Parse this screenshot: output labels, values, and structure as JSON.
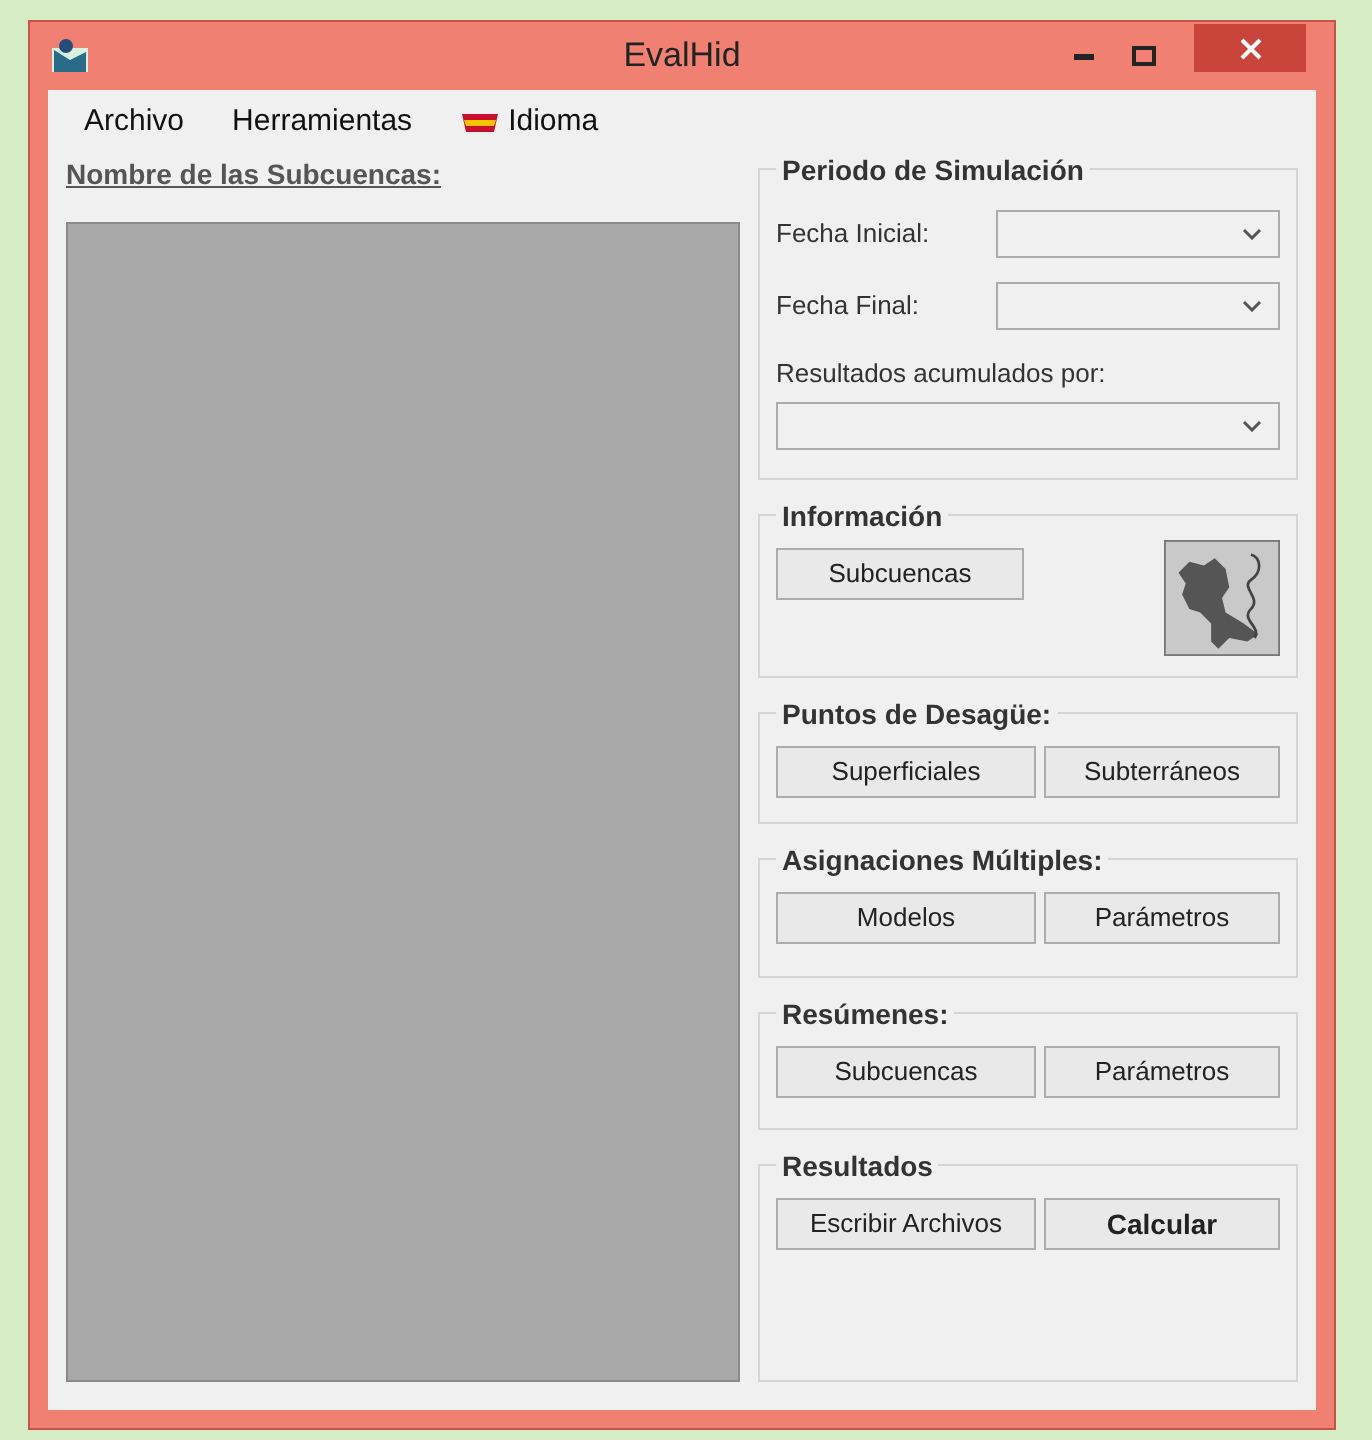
{
  "window": {
    "title": "EvalHid"
  },
  "menu": [
    {
      "label": "Archivo",
      "kind": "plain"
    },
    {
      "label": "Herramientas",
      "kind": "plain"
    },
    {
      "label": "Idioma",
      "kind": "flag"
    }
  ],
  "list": {
    "label": "Nombre de las Subcuencas:"
  },
  "groups": [
    {
      "title": "Periodo de Simulación",
      "kind": "fields",
      "fields": [
        {
          "label": "Fecha Inicial:",
          "kind": "inline"
        },
        {
          "label": "Fecha Final:",
          "kind": "inline"
        },
        {
          "label": "Resultados acumulados por:",
          "kind": "stacked"
        }
      ]
    },
    {
      "title": "Información",
      "kind": "logo",
      "buttons": [
        {
          "label": "Subcuencas",
          "bold": false
        }
      ]
    },
    {
      "title": "Puntos de Desagüe:",
      "kind": "buttons",
      "buttons": [
        {
          "label": "Superficiales",
          "bold": false
        },
        {
          "label": "Subterráneos",
          "bold": false
        }
      ]
    },
    {
      "title": "Asignaciones Múltiples:",
      "kind": "buttons",
      "buttons": [
        {
          "label": "Modelos",
          "bold": false
        },
        {
          "label": "Parámetros",
          "bold": false
        }
      ]
    },
    {
      "title": "Resúmenes:",
      "kind": "buttons",
      "buttons": [
        {
          "label": "Subcuencas",
          "bold": false
        },
        {
          "label": "Parámetros",
          "bold": false
        }
      ]
    },
    {
      "title": "Resultados",
      "kind": "buttons",
      "buttons": [
        {
          "label": "Escribir Archivos",
          "bold": false
        },
        {
          "label": "Calcular",
          "bold": true
        }
      ]
    }
  ]
}
